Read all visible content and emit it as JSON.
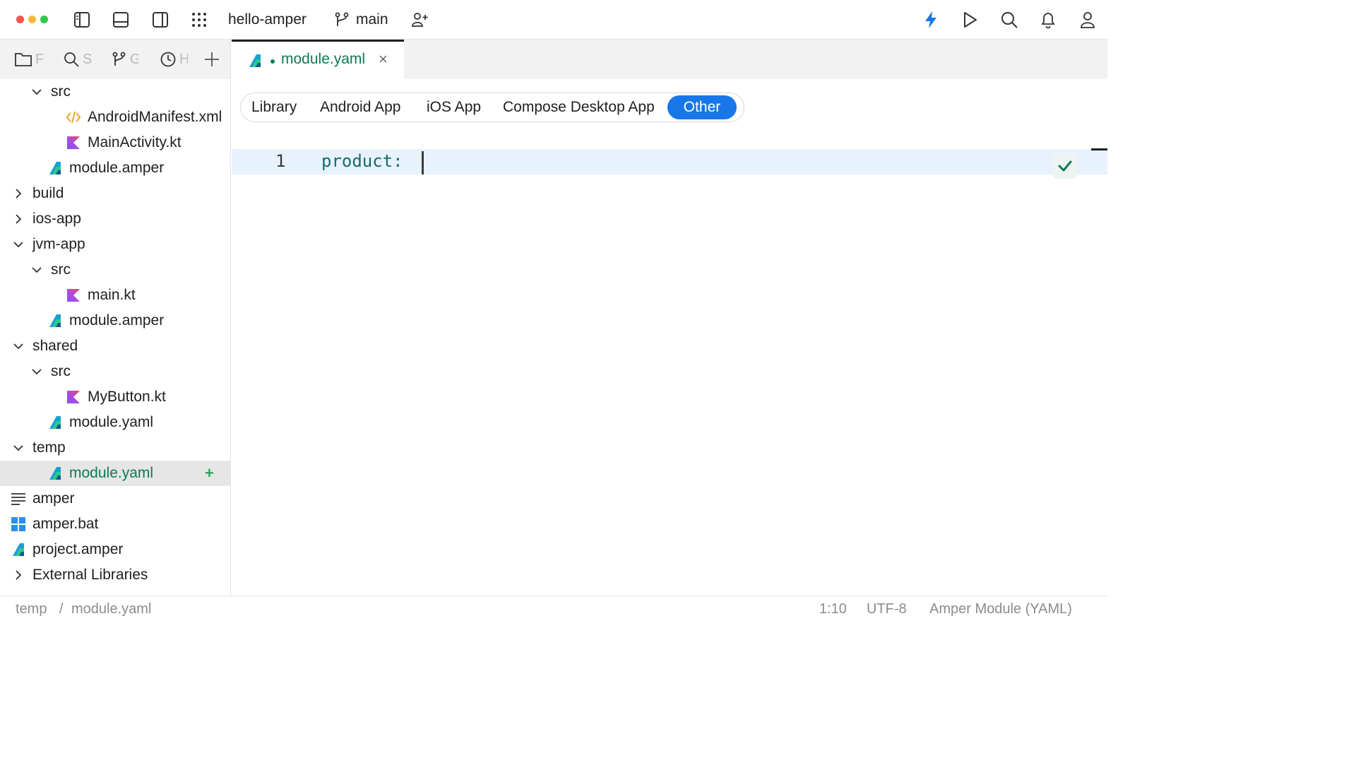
{
  "window": {
    "project_name": "hello-amper",
    "branch": "main",
    "traffic_colors": [
      "#f2564e",
      "#f6b93c",
      "#34c749"
    ],
    "accent": "#1877e8"
  },
  "toolbar": {
    "icons": [
      "sidebar-left-icon",
      "bottom-panel-icon",
      "sidebar-right-icon",
      "apps-grid-icon",
      "branch-icon",
      "add-user-icon",
      "lightning-icon",
      "run-icon",
      "search-icon",
      "bell-icon",
      "account-icon"
    ]
  },
  "sidebar": {
    "tabs": [
      {
        "icon": "folder-icon",
        "label": "F"
      },
      {
        "icon": "search-icon",
        "label": "S"
      },
      {
        "icon": "git-icon",
        "label": "G"
      },
      {
        "icon": "history-icon",
        "label": "H"
      }
    ],
    "tree": [
      {
        "label": "src",
        "depth": 1,
        "chevron": "down",
        "icon": "none"
      },
      {
        "label": "AndroidManifest.xml",
        "depth": 2,
        "chevron": "none",
        "icon": "xml"
      },
      {
        "label": "MainActivity.kt",
        "depth": 2,
        "chevron": "none",
        "icon": "kotlin"
      },
      {
        "label": "module.amper",
        "depth": 1,
        "chevron": "none",
        "icon": "amper"
      },
      {
        "label": "build",
        "depth": 0,
        "chevron": "right",
        "icon": "none"
      },
      {
        "label": "ios-app",
        "depth": 0,
        "chevron": "right",
        "icon": "none"
      },
      {
        "label": "jvm-app",
        "depth": 0,
        "chevron": "down",
        "icon": "none"
      },
      {
        "label": "src",
        "depth": 1,
        "chevron": "down",
        "icon": "none"
      },
      {
        "label": "main.kt",
        "depth": 2,
        "chevron": "none",
        "icon": "kotlin"
      },
      {
        "label": "module.amper",
        "depth": 1,
        "chevron": "none",
        "icon": "amper"
      },
      {
        "label": "shared",
        "depth": 0,
        "chevron": "down",
        "icon": "none"
      },
      {
        "label": "src",
        "depth": 1,
        "chevron": "down",
        "icon": "none"
      },
      {
        "label": "MyButton.kt",
        "depth": 2,
        "chevron": "none",
        "icon": "kotlin"
      },
      {
        "label": "module.yaml",
        "depth": 1,
        "chevron": "none",
        "icon": "amper"
      },
      {
        "label": "temp",
        "depth": 0,
        "chevron": "down",
        "icon": "none"
      },
      {
        "label": "module.yaml",
        "depth": 1,
        "chevron": "none",
        "icon": "amper",
        "selected": true,
        "added": "+"
      },
      {
        "label": "amper",
        "depth": 0,
        "chevron": "none",
        "icon": "text"
      },
      {
        "label": "amper.bat",
        "depth": 0,
        "chevron": "none",
        "icon": "windows"
      },
      {
        "label": "project.amper",
        "depth": 0,
        "chevron": "none",
        "icon": "amper"
      },
      {
        "label": "External Libraries",
        "depth": 0,
        "chevron": "right",
        "icon": "none"
      }
    ]
  },
  "editor": {
    "tab": {
      "label": "module.yaml",
      "modified": true
    },
    "templates": [
      "Library",
      "Android App",
      "iOS App",
      "Compose Desktop App",
      "Other"
    ],
    "selected_template": "Other",
    "lines": [
      {
        "number": "1",
        "text": "product:"
      }
    ]
  },
  "status": {
    "breadcrumb_folder": "temp",
    "breadcrumb_sep": "/",
    "breadcrumb_file": "module.yaml",
    "position": "1:10",
    "encoding": "UTF-8",
    "file_type": "Amper Module (YAML)"
  }
}
